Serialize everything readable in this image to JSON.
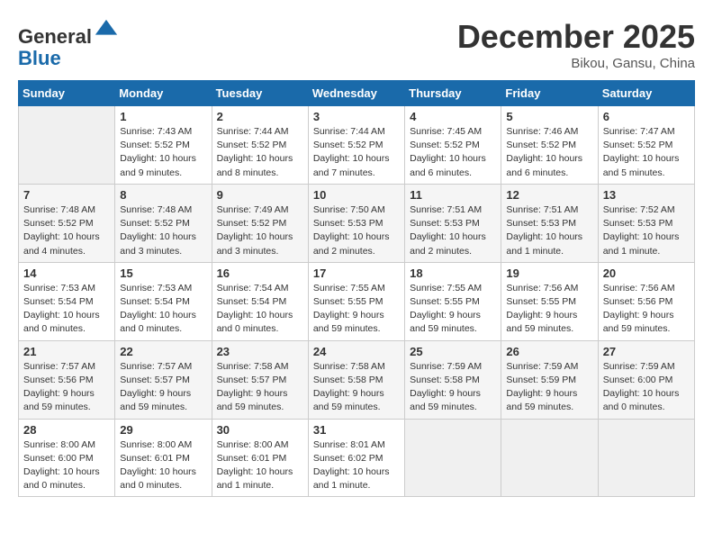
{
  "header": {
    "logo_line1": "General",
    "logo_line2": "Blue",
    "month_title": "December 2025",
    "location": "Bikou, Gansu, China"
  },
  "days_of_week": [
    "Sunday",
    "Monday",
    "Tuesday",
    "Wednesday",
    "Thursday",
    "Friday",
    "Saturday"
  ],
  "weeks": [
    [
      {
        "day": "",
        "empty": true
      },
      {
        "day": "1",
        "sunrise": "Sunrise: 7:43 AM",
        "sunset": "Sunset: 5:52 PM",
        "daylight": "Daylight: 10 hours and 9 minutes."
      },
      {
        "day": "2",
        "sunrise": "Sunrise: 7:44 AM",
        "sunset": "Sunset: 5:52 PM",
        "daylight": "Daylight: 10 hours and 8 minutes."
      },
      {
        "day": "3",
        "sunrise": "Sunrise: 7:44 AM",
        "sunset": "Sunset: 5:52 PM",
        "daylight": "Daylight: 10 hours and 7 minutes."
      },
      {
        "day": "4",
        "sunrise": "Sunrise: 7:45 AM",
        "sunset": "Sunset: 5:52 PM",
        "daylight": "Daylight: 10 hours and 6 minutes."
      },
      {
        "day": "5",
        "sunrise": "Sunrise: 7:46 AM",
        "sunset": "Sunset: 5:52 PM",
        "daylight": "Daylight: 10 hours and 6 minutes."
      },
      {
        "day": "6",
        "sunrise": "Sunrise: 7:47 AM",
        "sunset": "Sunset: 5:52 PM",
        "daylight": "Daylight: 10 hours and 5 minutes."
      }
    ],
    [
      {
        "day": "7",
        "sunrise": "Sunrise: 7:48 AM",
        "sunset": "Sunset: 5:52 PM",
        "daylight": "Daylight: 10 hours and 4 minutes."
      },
      {
        "day": "8",
        "sunrise": "Sunrise: 7:48 AM",
        "sunset": "Sunset: 5:52 PM",
        "daylight": "Daylight: 10 hours and 3 minutes."
      },
      {
        "day": "9",
        "sunrise": "Sunrise: 7:49 AM",
        "sunset": "Sunset: 5:52 PM",
        "daylight": "Daylight: 10 hours and 3 minutes."
      },
      {
        "day": "10",
        "sunrise": "Sunrise: 7:50 AM",
        "sunset": "Sunset: 5:53 PM",
        "daylight": "Daylight: 10 hours and 2 minutes."
      },
      {
        "day": "11",
        "sunrise": "Sunrise: 7:51 AM",
        "sunset": "Sunset: 5:53 PM",
        "daylight": "Daylight: 10 hours and 2 minutes."
      },
      {
        "day": "12",
        "sunrise": "Sunrise: 7:51 AM",
        "sunset": "Sunset: 5:53 PM",
        "daylight": "Daylight: 10 hours and 1 minute."
      },
      {
        "day": "13",
        "sunrise": "Sunrise: 7:52 AM",
        "sunset": "Sunset: 5:53 PM",
        "daylight": "Daylight: 10 hours and 1 minute."
      }
    ],
    [
      {
        "day": "14",
        "sunrise": "Sunrise: 7:53 AM",
        "sunset": "Sunset: 5:54 PM",
        "daylight": "Daylight: 10 hours and 0 minutes."
      },
      {
        "day": "15",
        "sunrise": "Sunrise: 7:53 AM",
        "sunset": "Sunset: 5:54 PM",
        "daylight": "Daylight: 10 hours and 0 minutes."
      },
      {
        "day": "16",
        "sunrise": "Sunrise: 7:54 AM",
        "sunset": "Sunset: 5:54 PM",
        "daylight": "Daylight: 10 hours and 0 minutes."
      },
      {
        "day": "17",
        "sunrise": "Sunrise: 7:55 AM",
        "sunset": "Sunset: 5:55 PM",
        "daylight": "Daylight: 9 hours and 59 minutes."
      },
      {
        "day": "18",
        "sunrise": "Sunrise: 7:55 AM",
        "sunset": "Sunset: 5:55 PM",
        "daylight": "Daylight: 9 hours and 59 minutes."
      },
      {
        "day": "19",
        "sunrise": "Sunrise: 7:56 AM",
        "sunset": "Sunset: 5:55 PM",
        "daylight": "Daylight: 9 hours and 59 minutes."
      },
      {
        "day": "20",
        "sunrise": "Sunrise: 7:56 AM",
        "sunset": "Sunset: 5:56 PM",
        "daylight": "Daylight: 9 hours and 59 minutes."
      }
    ],
    [
      {
        "day": "21",
        "sunrise": "Sunrise: 7:57 AM",
        "sunset": "Sunset: 5:56 PM",
        "daylight": "Daylight: 9 hours and 59 minutes."
      },
      {
        "day": "22",
        "sunrise": "Sunrise: 7:57 AM",
        "sunset": "Sunset: 5:57 PM",
        "daylight": "Daylight: 9 hours and 59 minutes."
      },
      {
        "day": "23",
        "sunrise": "Sunrise: 7:58 AM",
        "sunset": "Sunset: 5:57 PM",
        "daylight": "Daylight: 9 hours and 59 minutes."
      },
      {
        "day": "24",
        "sunrise": "Sunrise: 7:58 AM",
        "sunset": "Sunset: 5:58 PM",
        "daylight": "Daylight: 9 hours and 59 minutes."
      },
      {
        "day": "25",
        "sunrise": "Sunrise: 7:59 AM",
        "sunset": "Sunset: 5:58 PM",
        "daylight": "Daylight: 9 hours and 59 minutes."
      },
      {
        "day": "26",
        "sunrise": "Sunrise: 7:59 AM",
        "sunset": "Sunset: 5:59 PM",
        "daylight": "Daylight: 9 hours and 59 minutes."
      },
      {
        "day": "27",
        "sunrise": "Sunrise: 7:59 AM",
        "sunset": "Sunset: 6:00 PM",
        "daylight": "Daylight: 10 hours and 0 minutes."
      }
    ],
    [
      {
        "day": "28",
        "sunrise": "Sunrise: 8:00 AM",
        "sunset": "Sunset: 6:00 PM",
        "daylight": "Daylight: 10 hours and 0 minutes."
      },
      {
        "day": "29",
        "sunrise": "Sunrise: 8:00 AM",
        "sunset": "Sunset: 6:01 PM",
        "daylight": "Daylight: 10 hours and 0 minutes."
      },
      {
        "day": "30",
        "sunrise": "Sunrise: 8:00 AM",
        "sunset": "Sunset: 6:01 PM",
        "daylight": "Daylight: 10 hours and 1 minute."
      },
      {
        "day": "31",
        "sunrise": "Sunrise: 8:01 AM",
        "sunset": "Sunset: 6:02 PM",
        "daylight": "Daylight: 10 hours and 1 minute."
      },
      {
        "day": "",
        "empty": true
      },
      {
        "day": "",
        "empty": true
      },
      {
        "day": "",
        "empty": true
      }
    ]
  ]
}
